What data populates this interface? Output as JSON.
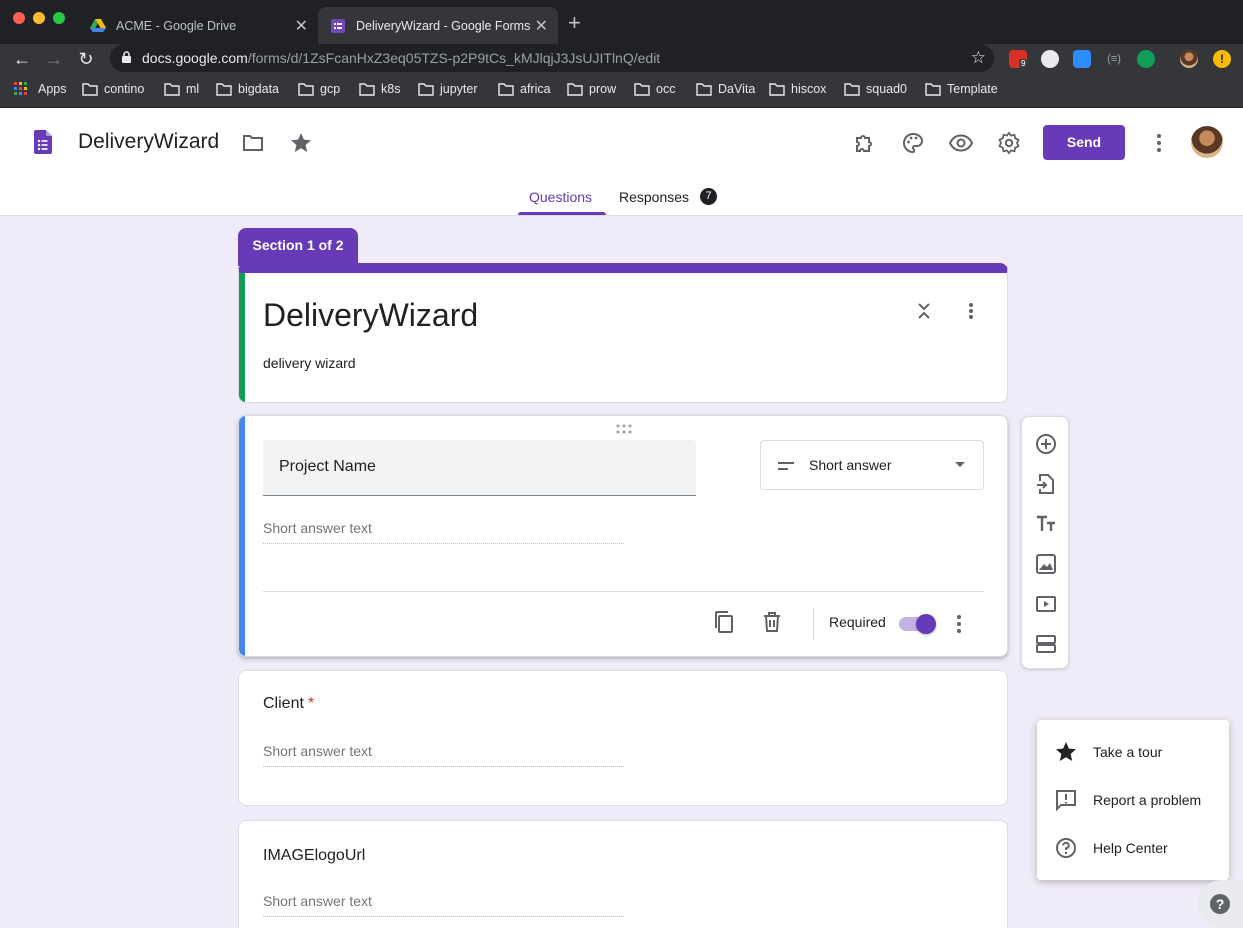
{
  "browser": {
    "tabs": [
      {
        "title": "ACME - Google Drive",
        "active": false
      },
      {
        "title": "DeliveryWizard - Google Forms",
        "active": true
      }
    ],
    "url_host": "docs.google.com",
    "url_path": "/forms/d/1ZsFcanHxZ3eq05TZS-p2P9tCs_kMJlqjJ3JsUJITlnQ/edit",
    "extension_badge": "9",
    "bookmarks": [
      "Apps",
      "contino",
      "ml",
      "bigdata",
      "gcp",
      "k8s",
      "jupyter",
      "africa",
      "prow",
      "occ",
      "DaVita",
      "hiscox",
      "squad0",
      "Template"
    ]
  },
  "header": {
    "title": "DeliveryWizard",
    "send_label": "Send",
    "tabs": {
      "questions": "Questions",
      "responses": "Responses",
      "responses_count": "7"
    }
  },
  "form": {
    "section_label": "Section 1 of 2",
    "title": "DeliveryWizard",
    "description": "delivery wizard",
    "active_question": {
      "title": "Project Name",
      "type": "Short answer",
      "placeholder": "Short answer text",
      "required_label": "Required",
      "required": true
    },
    "questions": [
      {
        "title": "Client",
        "required_mark": "*",
        "placeholder": "Short answer text"
      },
      {
        "title": "IMAGElogoUrl",
        "placeholder": "Short answer text"
      }
    ]
  },
  "help_menu": {
    "items": [
      "Take a tour",
      "Report a problem",
      "Help Center"
    ]
  },
  "colors": {
    "accent": "#673ab7",
    "background": "#f0ebf8",
    "active_bar": "#4285f4",
    "title_bar": "#0f9d58"
  }
}
